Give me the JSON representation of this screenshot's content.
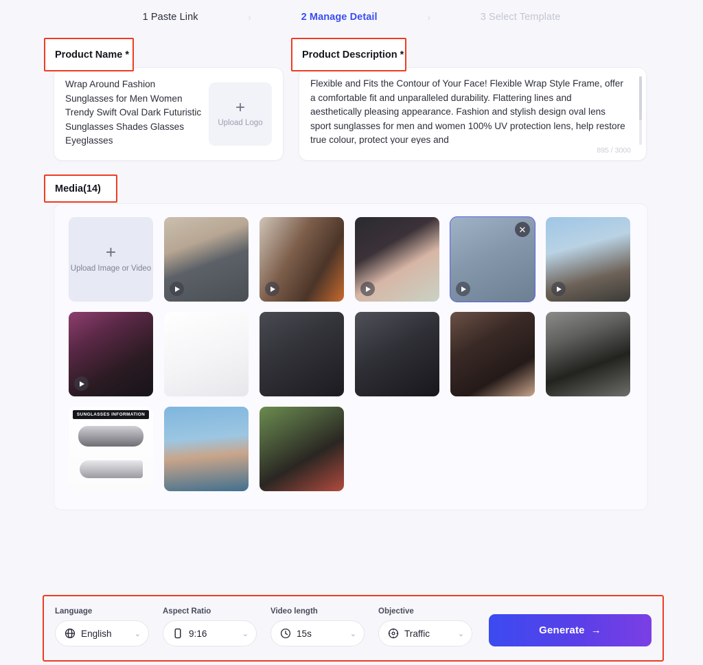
{
  "stepper": {
    "separator": "›",
    "steps": [
      {
        "label": "1 Paste Link",
        "state": "done"
      },
      {
        "label": "2 Manage Detail",
        "state": "active"
      },
      {
        "label": "3 Select Template",
        "state": "todo"
      }
    ]
  },
  "annotations": {
    "product_name_label": "Product Name *",
    "product_description_label": "Product Description *",
    "media_label": "Media(14)",
    "color": "#ee3b22"
  },
  "product_name": {
    "value": " Wrap Around Fashion Sunglasses for Men Women Trendy Swift Oval Dark Futuristic Sunglasses Shades Glasses Eyeglasses",
    "upload_logo_label": "Upload Logo",
    "plus_glyph": "+"
  },
  "product_description": {
    "value": "Flexible and Fits the Contour of Your Face! Flexible Wrap Style Frame, offer a comfortable fit and unparalleled durability.\nFlattering lines and aesthetically pleasing appearance. Fashion and stylish design oval lens sport sunglasses for men and women\n100% UV protection lens, help restore true colour, protect your eyes and",
    "counter": "895 / 3000"
  },
  "media": {
    "count_label": "Media(14)",
    "upload_label": "Upload Image or Video",
    "plus_glyph": "+",
    "close_glyph": "✕",
    "tiles": [
      {
        "name": "upload-tile",
        "kind": "upload"
      },
      {
        "name": "media-man-sunglasses-indoor",
        "kind": "video"
      },
      {
        "name": "media-woman-white-frames",
        "kind": "video"
      },
      {
        "name": "media-woman-cateye-closeup",
        "kind": "video"
      },
      {
        "name": "media-hand-holding-sunglasses",
        "kind": "video",
        "selected": true
      },
      {
        "name": "media-woman-outdoor-selfie",
        "kind": "video"
      },
      {
        "name": "media-woman-neon-necklace",
        "kind": "video"
      },
      {
        "name": "media-product-silver-frame",
        "kind": "image"
      },
      {
        "name": "media-woman-black-jacket",
        "kind": "image"
      },
      {
        "name": "media-woman-holding-can",
        "kind": "image"
      },
      {
        "name": "media-group-party",
        "kind": "image"
      },
      {
        "name": "media-person-street-black",
        "kind": "image"
      },
      {
        "name": "media-sunglasses-information",
        "kind": "image",
        "caption": "SUNGLASSES INFORMATION"
      },
      {
        "name": "media-woman-beach-bridge",
        "kind": "image"
      },
      {
        "name": "media-couple-sunglasses",
        "kind": "image"
      }
    ]
  },
  "bottom_bar": {
    "controls": [
      {
        "label": "Language",
        "value": "English",
        "icon": "globe-icon",
        "name": "language-select"
      },
      {
        "label": "Aspect Ratio",
        "value": "9:16",
        "icon": "phone-icon",
        "name": "aspect-ratio-select"
      },
      {
        "label": "Video length",
        "value": "15s",
        "icon": "clock-icon",
        "name": "video-length-select"
      },
      {
        "label": "Objective",
        "value": "Traffic",
        "icon": "target-icon",
        "name": "objective-select"
      }
    ],
    "chevron": "⌄",
    "generate_label": "Generate",
    "generate_arrow": "→",
    "generate_gradient_from": "#3b4bf0",
    "generate_gradient_to": "#7b3fe4"
  }
}
